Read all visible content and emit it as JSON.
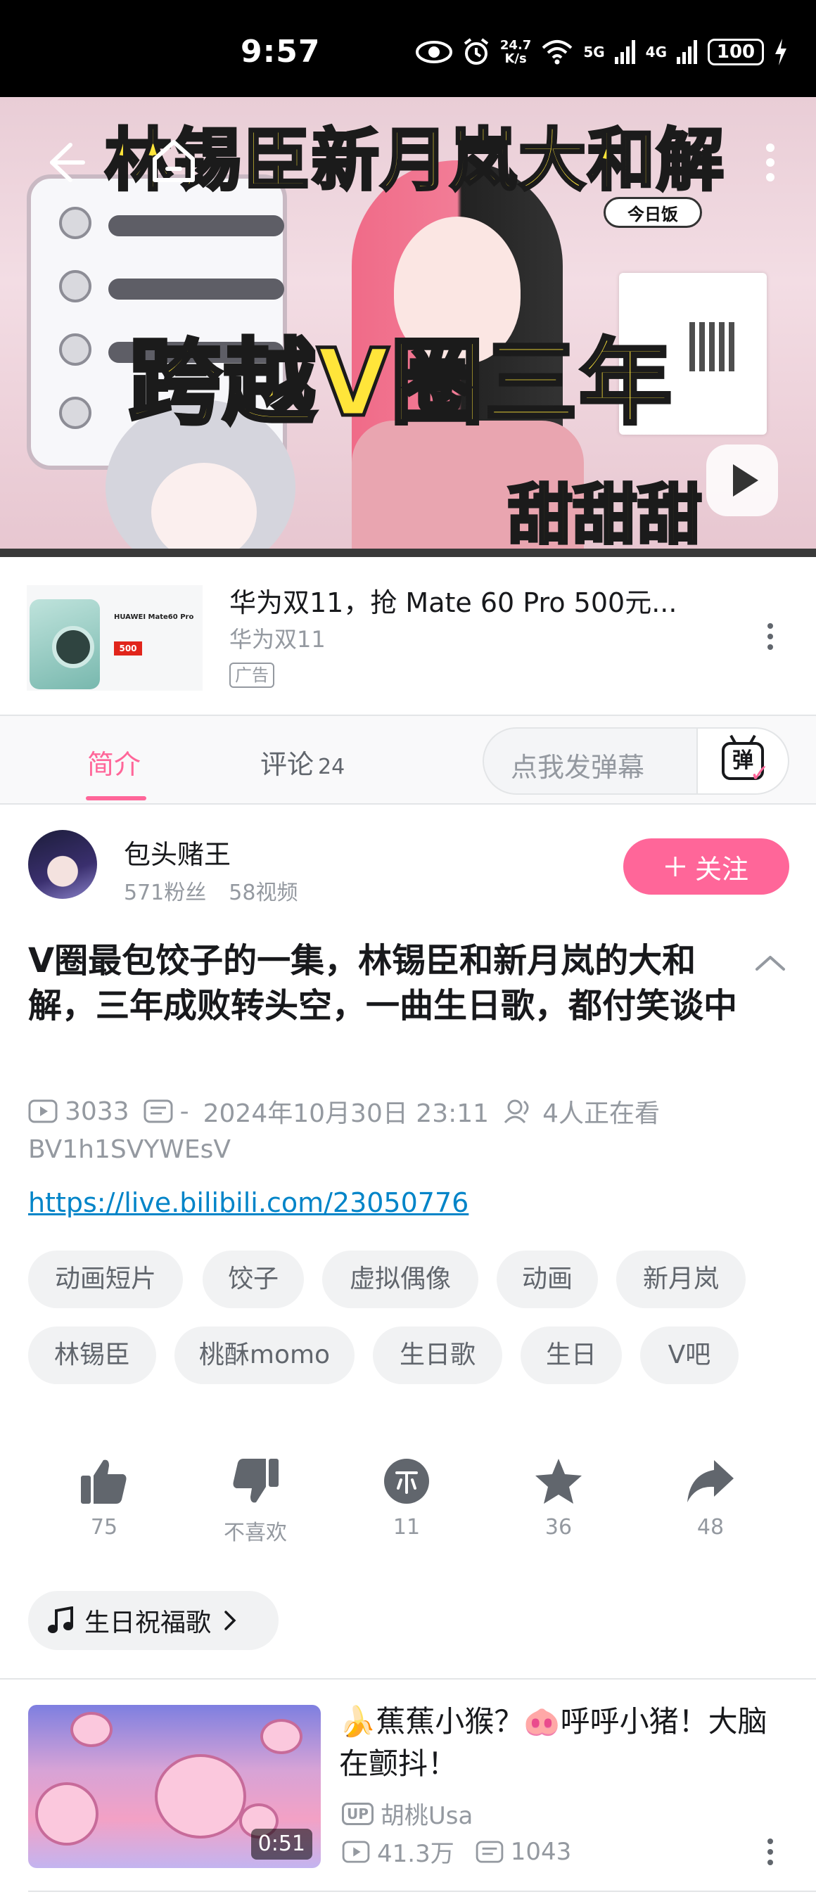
{
  "status_bar": {
    "time": "9:57",
    "speed_value": "24.7",
    "speed_unit": "K/s",
    "net1": "5G",
    "net2": "4G",
    "battery": "100",
    "icons": [
      "eye-icon",
      "alarm-icon",
      "wifi-icon",
      "signal-5g-icon",
      "signal-4g-icon",
      "battery-icon",
      "charging-icon"
    ]
  },
  "player": {
    "title_overlay": "林锡臣新月岚大和解",
    "subtitle_overlay": "跨越V圈三年",
    "sign_overlay": "甜甜甜",
    "badge": "今日饭",
    "icons": [
      "back-icon",
      "home-icon",
      "more-icon",
      "play-icon"
    ]
  },
  "ad": {
    "title": "华为双11，抢 Mate 60 Pro 500元...",
    "subtitle": "华为双11",
    "tag": "广告",
    "thumb_text": "HUAWEI Mate60 Pro",
    "thumb_price": "500"
  },
  "tabs": {
    "intro": "简介",
    "comments": "评论",
    "comments_count": "24",
    "danmaku_placeholder": "点我发弹幕",
    "danmaku_icon_label": "弹"
  },
  "uploader": {
    "name": "包头赌王",
    "fans": "571粉丝",
    "videos": "58视频",
    "follow_label": "关注"
  },
  "video": {
    "title": "V圈最包饺子的一集，林锡臣和新月岚的大和解，三年成败转头空，一曲生日歌，都付笑谈中",
    "views": "3033",
    "danmaku": "-",
    "date": "2024年10月30日 23:11",
    "watching": "4人正在看",
    "bvid": "BV1h1SVYWEsV",
    "link": "https://live.bilibili.com/23050776"
  },
  "tags": [
    "动画短片",
    "饺子",
    "虚拟偶像",
    "动画",
    "新月岚",
    "林锡臣",
    "桃酥momo",
    "生日歌",
    "生日",
    "V吧"
  ],
  "actions": {
    "like": "75",
    "dislike": "不喜欢",
    "coin": "11",
    "favorite": "36",
    "share": "48"
  },
  "music": {
    "label": "生日祝福歌"
  },
  "related": {
    "title": "🍌蕉蕉小猴？🐽呼呼小猪！大脑在颤抖！",
    "duration": "0:51",
    "up_badge": "UP",
    "author": "胡桃Usa",
    "views": "41.3万",
    "danmaku": "1043"
  },
  "colors": {
    "accent": "#ff6699",
    "link": "#0084c8",
    "muted": "#9499a0",
    "text": "#18191c"
  }
}
